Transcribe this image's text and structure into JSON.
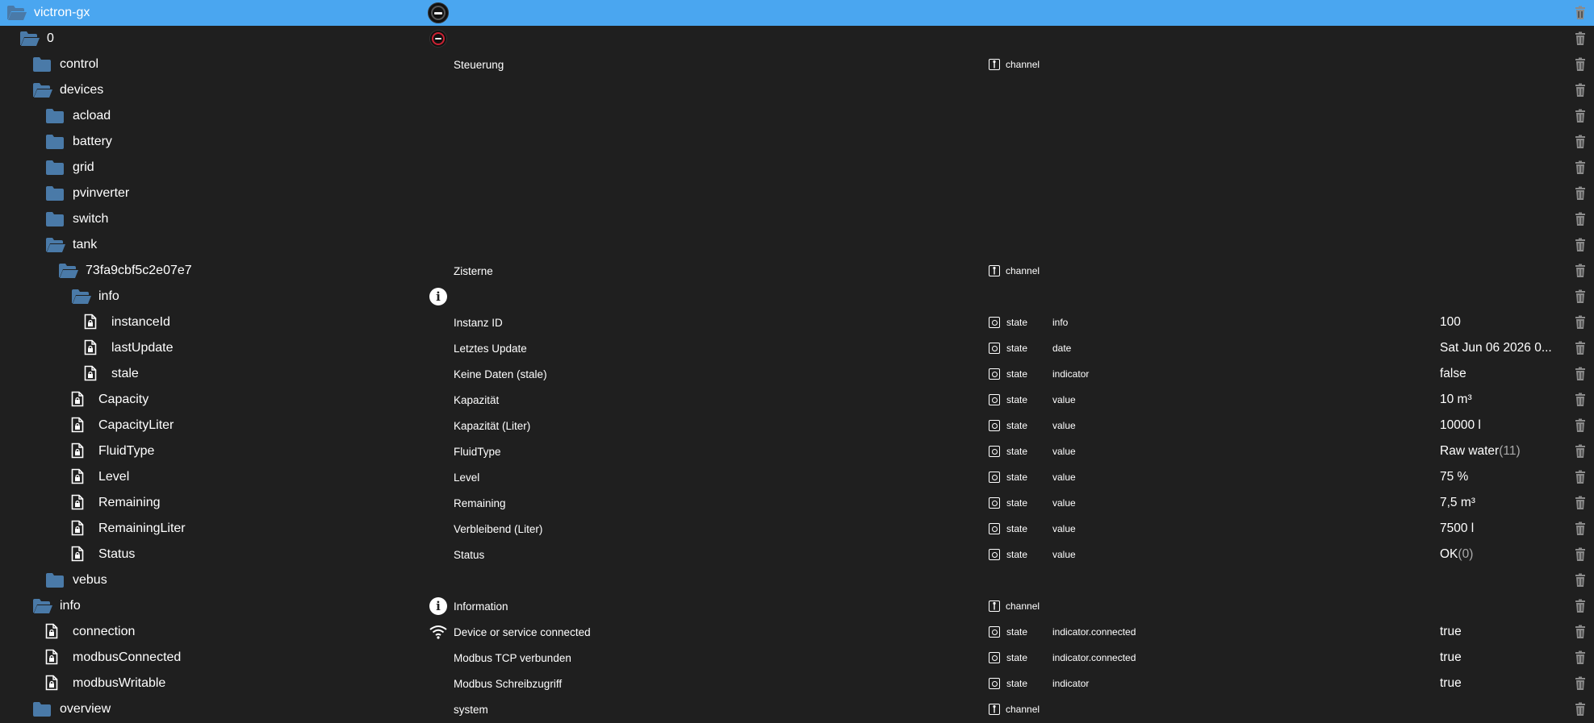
{
  "colors": {
    "background": "#1f1f1f",
    "selected": "#4aa6f0",
    "folder": "#4a7aa8",
    "trash": "#8a8a8a"
  },
  "tree": [
    {
      "name": "victron-gx",
      "level": 0,
      "icon": "folder-open-icon",
      "selected": true,
      "special": "avatar"
    },
    {
      "name": "0",
      "level": 1,
      "icon": "folder-open-icon",
      "special": "avatar-small"
    },
    {
      "name": "control",
      "level": 2,
      "icon": "folder-icon",
      "desc": "Steuerung",
      "type": "channel"
    },
    {
      "name": "devices",
      "level": 2,
      "icon": "folder-open-icon"
    },
    {
      "name": "acload",
      "level": 3,
      "icon": "folder-icon"
    },
    {
      "name": "battery",
      "level": 3,
      "icon": "folder-icon"
    },
    {
      "name": "grid",
      "level": 3,
      "icon": "folder-icon"
    },
    {
      "name": "pvinverter",
      "level": 3,
      "icon": "folder-icon"
    },
    {
      "name": "switch",
      "level": 3,
      "icon": "folder-icon"
    },
    {
      "name": "tank",
      "level": 3,
      "icon": "folder-open-icon"
    },
    {
      "name": "73fa9cbf5c2e07e7",
      "level": 4,
      "icon": "folder-open-icon",
      "desc": "Zisterne",
      "type": "channel"
    },
    {
      "name": "info",
      "level": 5,
      "icon": "folder-open-icon",
      "special": "info-icon"
    },
    {
      "name": "instanceId",
      "level": 6,
      "icon": "file-lock-icon",
      "desc": "Instanz ID",
      "type": "state",
      "role": "info",
      "value": "100"
    },
    {
      "name": "lastUpdate",
      "level": 6,
      "icon": "file-lock-icon",
      "desc": "Letztes Update",
      "type": "state",
      "role": "date",
      "value": "Sat Jun 06 2026 0..."
    },
    {
      "name": "stale",
      "level": 6,
      "icon": "file-lock-icon",
      "desc": "Keine Daten (stale)",
      "type": "state",
      "role": "indicator",
      "value": "false"
    },
    {
      "name": "Capacity",
      "level": 5,
      "icon": "file-lock-icon",
      "desc": "Kapazität",
      "type": "state",
      "role": "value",
      "value": "10 m³"
    },
    {
      "name": "CapacityLiter",
      "level": 5,
      "icon": "file-lock-icon",
      "desc": "Kapazität (Liter)",
      "type": "state",
      "role": "value",
      "value": "10000 l"
    },
    {
      "name": "FluidType",
      "level": 5,
      "icon": "file-lock-icon",
      "desc": "FluidType",
      "type": "state",
      "role": "value",
      "value": "Raw water",
      "value_suffix": "(11)"
    },
    {
      "name": "Level",
      "level": 5,
      "icon": "file-lock-icon",
      "desc": "Level",
      "type": "state",
      "role": "value",
      "value": "75 %"
    },
    {
      "name": "Remaining",
      "level": 5,
      "icon": "file-lock-icon",
      "desc": "Remaining",
      "type": "state",
      "role": "value",
      "value": "7,5 m³"
    },
    {
      "name": "RemainingLiter",
      "level": 5,
      "icon": "file-lock-icon",
      "desc": "Verbleibend (Liter)",
      "type": "state",
      "role": "value",
      "value": "7500 l"
    },
    {
      "name": "Status",
      "level": 5,
      "icon": "file-lock-icon",
      "desc": "Status",
      "type": "state",
      "role": "value",
      "value": "OK",
      "value_suffix": "(0)"
    },
    {
      "name": "vebus",
      "level": 3,
      "icon": "folder-icon"
    },
    {
      "name": "info",
      "level": 2,
      "icon": "folder-open-icon",
      "special": "info-icon",
      "desc": "Information",
      "type": "channel"
    },
    {
      "name": "connection",
      "level": 3,
      "icon": "file-lock-icon",
      "special": "wifi-icon",
      "desc": "Device or service connected",
      "type": "state",
      "role": "indicator.connected",
      "value": "true"
    },
    {
      "name": "modbusConnected",
      "level": 3,
      "icon": "file-lock-icon",
      "desc": "Modbus TCP verbunden",
      "type": "state",
      "role": "indicator.connected",
      "value": "true"
    },
    {
      "name": "modbusWritable",
      "level": 3,
      "icon": "file-lock-icon",
      "desc": "Modbus Schreibzugriff",
      "type": "state",
      "role": "indicator",
      "value": "true"
    },
    {
      "name": "overview",
      "level": 2,
      "icon": "folder-icon",
      "desc": "system",
      "type": "channel"
    }
  ]
}
